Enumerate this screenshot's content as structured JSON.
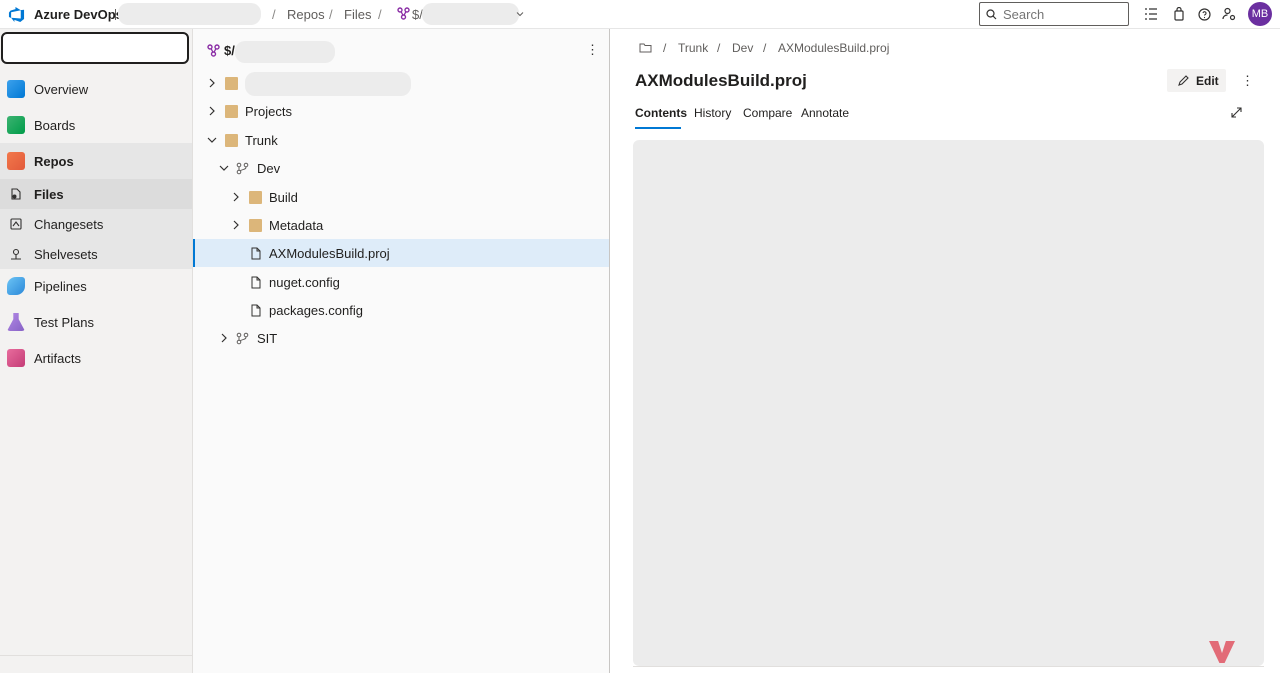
{
  "app": {
    "name": "Azure DevOps",
    "accent": "#0078d4",
    "avatar_initials": "MB",
    "avatar_color": "#6b2fa0"
  },
  "breadcrumbs": [
    "Repos",
    "Files",
    "$/"
  ],
  "search": {
    "placeholder": "Search",
    "value": ""
  },
  "toolbar_icons": [
    "list-check-icon",
    "shopping-bag-icon",
    "help-icon",
    "user-settings-icon"
  ],
  "leftnav": {
    "items": [
      {
        "label": "Overview",
        "icon": "overview-icon",
        "color": "#0078d4"
      },
      {
        "label": "Boards",
        "icon": "boards-icon",
        "color": "#009c49"
      },
      {
        "label": "Repos",
        "icon": "repos-icon",
        "color": "#e25a3b"
      },
      {
        "label": "Files",
        "icon": "files-icon"
      },
      {
        "label": "Changesets",
        "icon": "changesets-icon"
      },
      {
        "label": "Shelvesets",
        "icon": "shelvesets-icon"
      },
      {
        "label": "Pipelines",
        "icon": "pipelines-icon",
        "color": "#2b88d8"
      },
      {
        "label": "Test Plans",
        "icon": "test-plans-icon",
        "color": "#8661c5"
      },
      {
        "label": "Artifacts",
        "icon": "artifacts-icon",
        "color": "#c43c76"
      }
    ]
  },
  "tree": {
    "root_label": "$/",
    "rows": [
      {
        "label": "",
        "type": "folder",
        "expanded": false
      },
      {
        "label": "Projects",
        "type": "folder",
        "expanded": false
      },
      {
        "label": "Trunk",
        "type": "folder",
        "expanded": true
      },
      {
        "label": "Dev",
        "type": "branch",
        "expanded": true
      },
      {
        "label": "Build",
        "type": "folder",
        "expanded": false
      },
      {
        "label": "Metadata",
        "type": "folder",
        "expanded": false
      },
      {
        "label": "AXModulesBuild.proj",
        "type": "file",
        "selected": true
      },
      {
        "label": "nuget.config",
        "type": "file"
      },
      {
        "label": "packages.config",
        "type": "file"
      },
      {
        "label": "SIT",
        "type": "branch",
        "expanded": false
      }
    ]
  },
  "content": {
    "path": [
      "Trunk",
      "Dev",
      "AXModulesBuild.proj"
    ],
    "title": "AXModulesBuild.proj",
    "edit_label": "Edit",
    "tabs": [
      "Contents",
      "History",
      "Compare",
      "Annotate"
    ],
    "active_tab": "Contents"
  }
}
